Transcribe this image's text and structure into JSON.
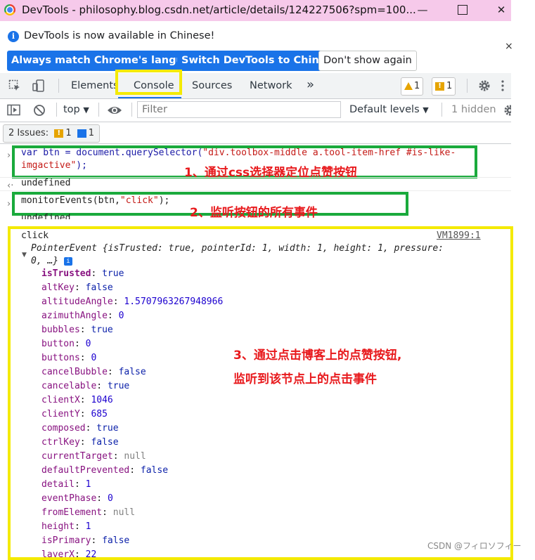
{
  "window": {
    "title": "DevTools - philosophy.blog.csdn.net/article/details/124227506?spm=100...",
    "minimize": "—",
    "close": "✕"
  },
  "infobar": {
    "message": "DevTools is now available in Chinese!",
    "btn_match": "Always match Chrome's language",
    "btn_switch": "Switch DevTools to Chinese",
    "btn_dont_show": "Don't show again",
    "close": "×"
  },
  "tabs": {
    "elements": "Elements",
    "console": "Console",
    "sources": "Sources",
    "network": "Network",
    "more": "»",
    "warnings_count": "1",
    "issues_count": "1"
  },
  "console_toolbar": {
    "context": "top",
    "filter_placeholder": "Filter",
    "levels": "Default levels",
    "hidden": "1 hidden"
  },
  "issues_bar": {
    "label": "2 Issues:",
    "warn_count": "1",
    "info_count": "1"
  },
  "console": {
    "cmd1_a": "var btn = document.querySelector(",
    "cmd1_str": "\"div.toolbox-middle a.tool-item-href #is-like-",
    "cmd1_b_str": "imgactive\"",
    "cmd1_b_end": ");",
    "undefined": "undefined",
    "cmd2_a": "monitorEvents(btn,",
    "cmd2_str": "\"click\"",
    "cmd2_end": ");",
    "log_label": "click",
    "log_source": "VM1899:1",
    "event_summary": "PointerEvent {isTrusted: true, pointerId: 1, width: 1, height: 1, pressure:",
    "event_summary_2": "0, …}",
    "props": [
      {
        "name": "isTrusted",
        "value": "true",
        "type": "bool",
        "bold": true
      },
      {
        "name": "altKey",
        "value": "false",
        "type": "bool"
      },
      {
        "name": "altitudeAngle",
        "value": "1.5707963267948966",
        "type": "num"
      },
      {
        "name": "azimuthAngle",
        "value": "0",
        "type": "num"
      },
      {
        "name": "bubbles",
        "value": "true",
        "type": "bool"
      },
      {
        "name": "button",
        "value": "0",
        "type": "num"
      },
      {
        "name": "buttons",
        "value": "0",
        "type": "num"
      },
      {
        "name": "cancelBubble",
        "value": "false",
        "type": "bool"
      },
      {
        "name": "cancelable",
        "value": "true",
        "type": "bool"
      },
      {
        "name": "clientX",
        "value": "1046",
        "type": "num"
      },
      {
        "name": "clientY",
        "value": "685",
        "type": "num"
      },
      {
        "name": "composed",
        "value": "true",
        "type": "bool"
      },
      {
        "name": "ctrlKey",
        "value": "false",
        "type": "bool"
      },
      {
        "name": "currentTarget",
        "value": "null",
        "type": "null"
      },
      {
        "name": "defaultPrevented",
        "value": "false",
        "type": "bool"
      },
      {
        "name": "detail",
        "value": "1",
        "type": "num"
      },
      {
        "name": "eventPhase",
        "value": "0",
        "type": "num"
      },
      {
        "name": "fromElement",
        "value": "null",
        "type": "null"
      },
      {
        "name": "height",
        "value": "1",
        "type": "num"
      },
      {
        "name": "isPrimary",
        "value": "false",
        "type": "bool"
      },
      {
        "name": "layerX",
        "value": "22",
        "type": "num"
      }
    ]
  },
  "annotations": {
    "a1": "1、通过css选择器定位点赞按钮",
    "a2": "2、监听按钮的所有事件",
    "a3_line1": "3、通过点击博客上的点赞按钮,",
    "a3_line2": "监听到该节点上的点击事件"
  },
  "watermark": "CSDN @フィロソフィー",
  "colors": {
    "titlebar": "#f6c9ea",
    "accent_blue": "#1a73e8",
    "highlight_yellow": "#f4ea00",
    "highlight_green": "#1aaa3c",
    "annotation_red": "#e8191c"
  }
}
